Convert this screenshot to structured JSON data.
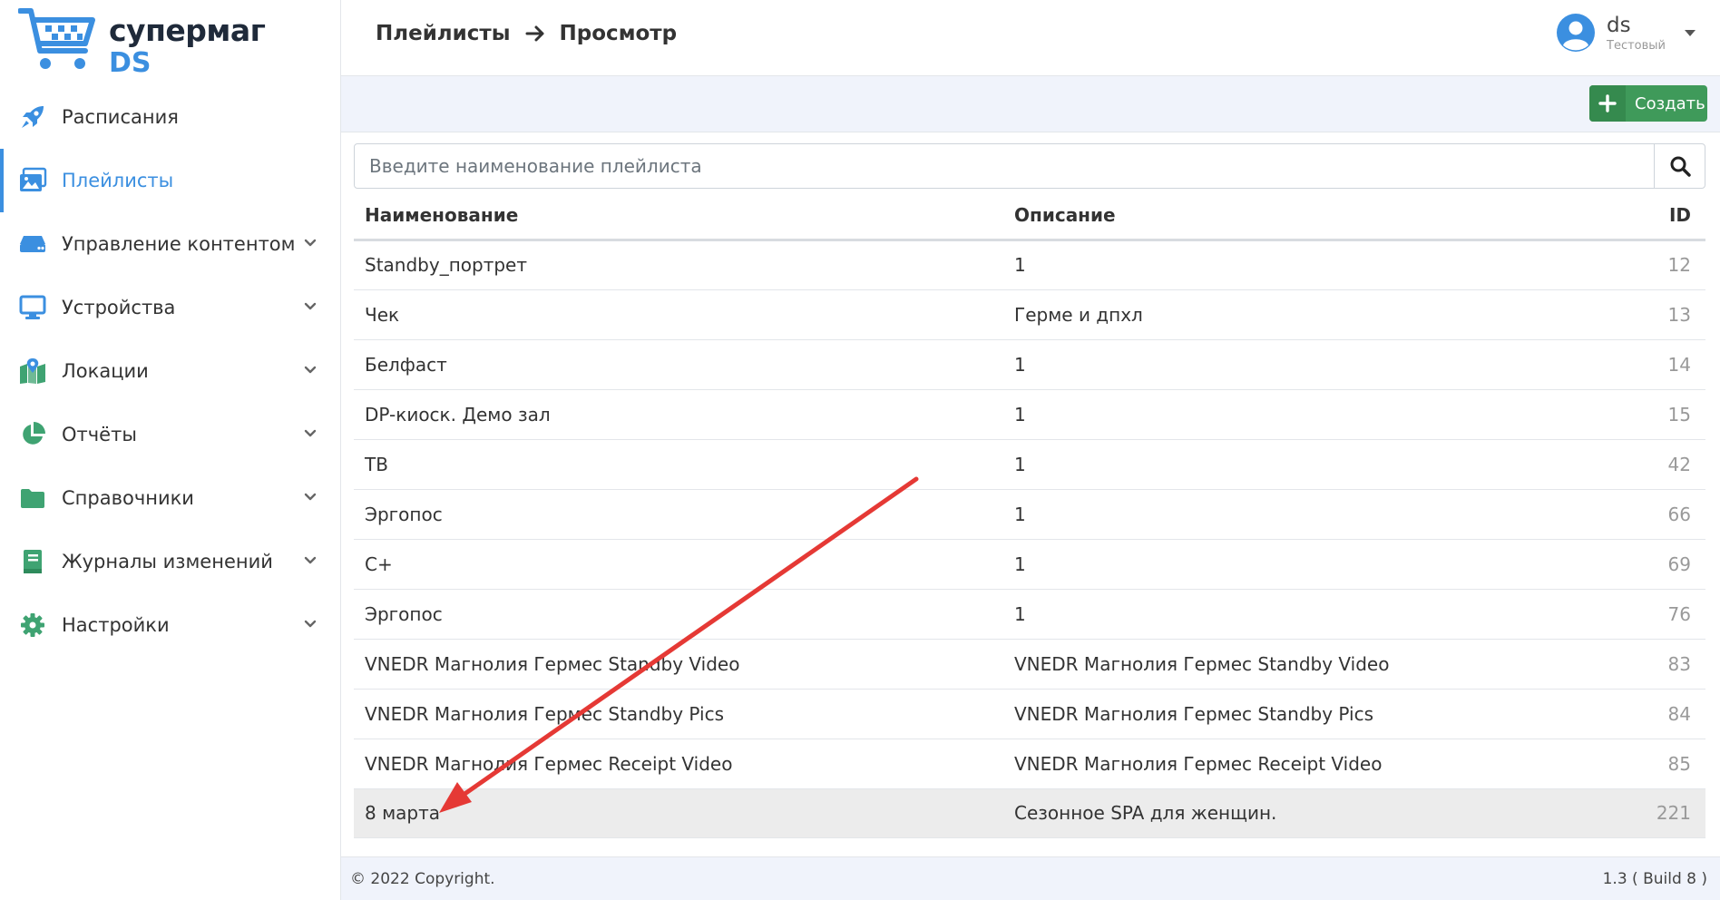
{
  "app": {
    "logo_line1": "супермаг",
    "logo_line2": "DS",
    "accent_color": "#3b8fe0"
  },
  "sidebar": {
    "items": [
      {
        "label": "Расписания",
        "icon": "rocket-icon",
        "active": false,
        "expandable": false
      },
      {
        "label": "Плейлисты",
        "icon": "images-icon",
        "active": true,
        "expandable": false
      },
      {
        "label": "Управление контентом",
        "icon": "hdd-icon",
        "active": false,
        "expandable": true
      },
      {
        "label": "Устройства",
        "icon": "monitor-icon",
        "active": false,
        "expandable": true
      },
      {
        "label": "Локации",
        "icon": "map-icon",
        "active": false,
        "expandable": true
      },
      {
        "label": "Отчёты",
        "icon": "pie-chart-icon",
        "active": false,
        "expandable": true
      },
      {
        "label": "Справочники",
        "icon": "folder-icon",
        "active": false,
        "expandable": true
      },
      {
        "label": "Журналы изменений",
        "icon": "book-icon",
        "active": false,
        "expandable": true
      },
      {
        "label": "Настройки",
        "icon": "gear-icon",
        "active": false,
        "expandable": true
      }
    ]
  },
  "header": {
    "breadcrumb": [
      "Плейлисты",
      "Просмотр"
    ],
    "user_name": "ds",
    "user_sub": "Тестовый"
  },
  "toolbar": {
    "create_label": "Создать",
    "create_color": "#3f9a5a"
  },
  "search": {
    "placeholder": "Введите наименование плейлиста",
    "value": ""
  },
  "table": {
    "columns": [
      "Наименование",
      "Описание",
      "ID"
    ],
    "rows": [
      {
        "name": "Standby_портрет",
        "desc": "1",
        "id": "12"
      },
      {
        "name": "Чек",
        "desc": "Герме и дпхл",
        "id": "13"
      },
      {
        "name": "Белфаст",
        "desc": "1",
        "id": "14"
      },
      {
        "name": "DP-киоск. Демо зал",
        "desc": "1",
        "id": "15"
      },
      {
        "name": "ТВ",
        "desc": "1",
        "id": "42"
      },
      {
        "name": "Эргопос",
        "desc": "1",
        "id": "66"
      },
      {
        "name": "С+",
        "desc": "1",
        "id": "69"
      },
      {
        "name": "Эргопос",
        "desc": "1",
        "id": "76"
      },
      {
        "name": "VNEDR Магнолия Гермес Standby Video",
        "desc": "VNEDR Магнолия Гермес Standby Video",
        "id": "83"
      },
      {
        "name": "VNEDR Магнолия Гермес Standby Pics",
        "desc": "VNEDR Магнолия Гермес Standby Pics",
        "id": "84"
      },
      {
        "name": "VNEDR Магнолия Гермес Receipt Video",
        "desc": "VNEDR Магнолия Гермес Receipt Video",
        "id": "85"
      },
      {
        "name": "8 марта",
        "desc": "Сезонное SPA для женщин.",
        "id": "221",
        "selected": true
      }
    ]
  },
  "footer": {
    "copyright": "© 2022 Copyright.",
    "version": "1.3 ( Build 8 )"
  },
  "annotation": {
    "color": "#e53935"
  }
}
